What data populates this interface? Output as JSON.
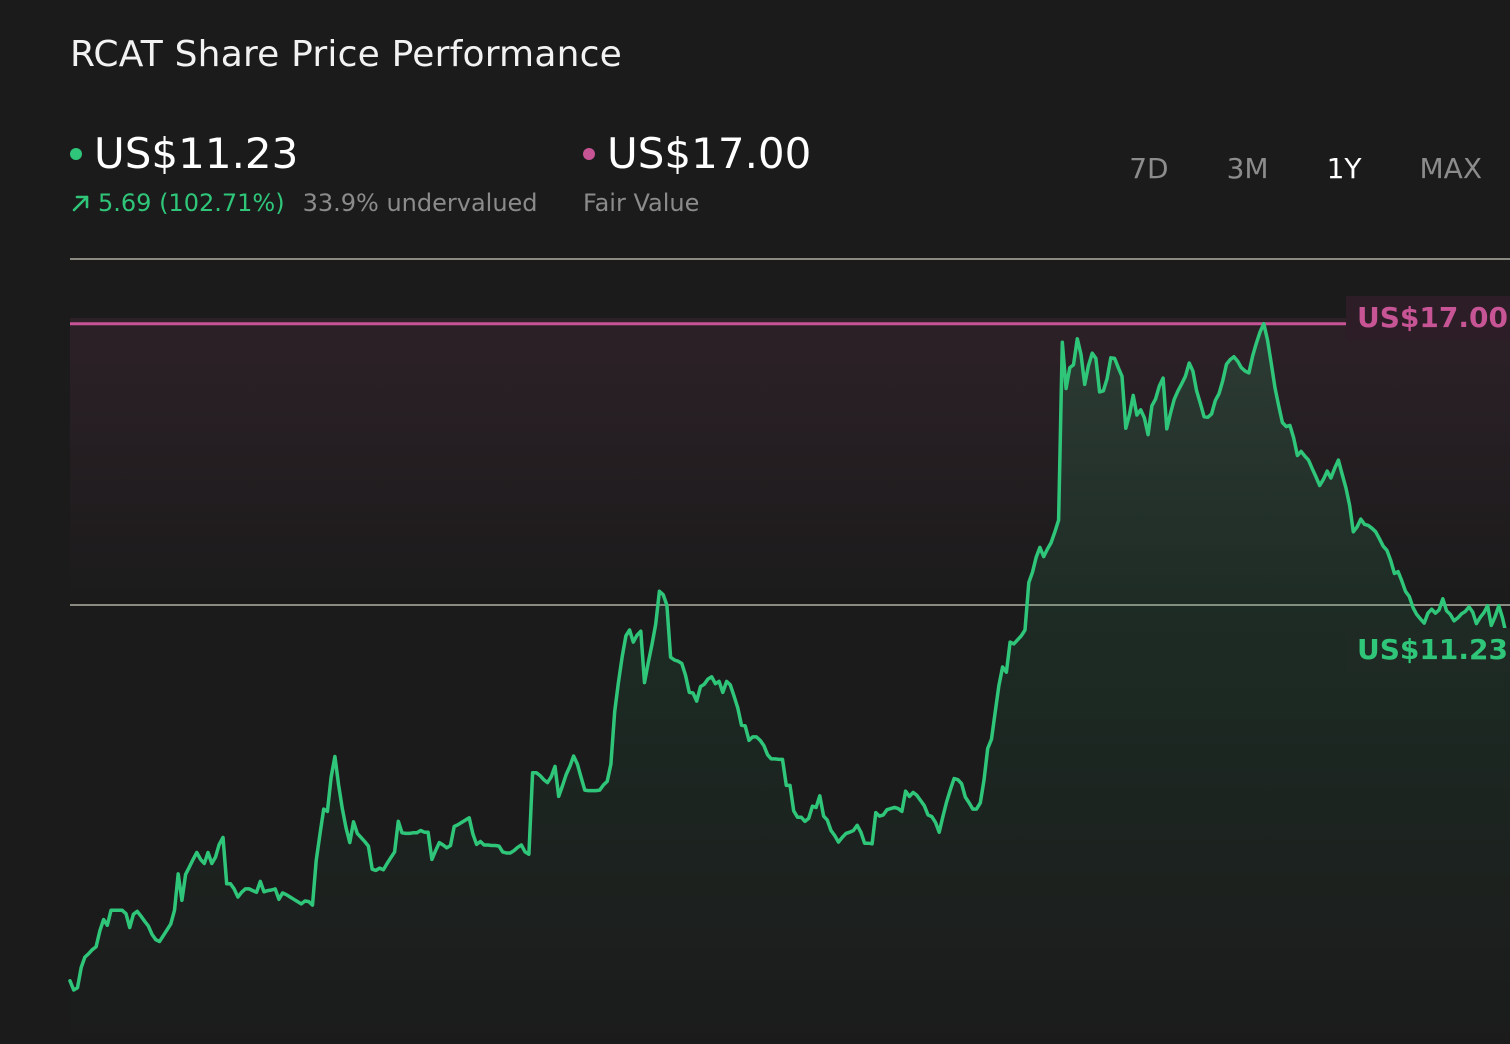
{
  "title": "RCAT Share Price Performance",
  "current": {
    "price": "US$11.23",
    "change": "5.69 (102.71%)",
    "valuation": "33.9% undervalued"
  },
  "fair_value": {
    "price": "US$17.00",
    "label": "Fair Value"
  },
  "range_tabs": [
    "7D",
    "3M",
    "1Y",
    "MAX"
  ],
  "active_range": "1Y",
  "colors": {
    "background": "#1b1b1b",
    "price_line": "#2fc67a",
    "fair_value_line": "#c75495",
    "gridline": "#8a8a80",
    "muted_text": "#8b8b8b"
  },
  "chart_data": {
    "type": "line",
    "series": [
      {
        "values": [
          5.63,
          5.47,
          5.51,
          5.86,
          6.04,
          6.1,
          6.17,
          6.22,
          6.49,
          6.69,
          6.59,
          6.85,
          6.85,
          6.85,
          6.85,
          6.79,
          6.55,
          6.78,
          6.83,
          6.75,
          6.66,
          6.58,
          6.43,
          6.34,
          6.31,
          6.41,
          6.51,
          6.61,
          6.85,
          7.48,
          7.02,
          7.47,
          7.6,
          7.73,
          7.85,
          7.73,
          7.66,
          7.85,
          7.66,
          7.77,
          7.99,
          8.11,
          7.31,
          7.31,
          7.22,
          7.08,
          7.16,
          7.22,
          7.22,
          7.19,
          7.16,
          7.35,
          7.17,
          7.19,
          7.2,
          7.22,
          7.04,
          7.15,
          7.12,
          7.08,
          7.04,
          7.0,
          6.96,
          7.01,
          7.0,
          6.94,
          7.71,
          8.16,
          8.6,
          8.56,
          9.15,
          9.51,
          9.02,
          8.61,
          8.27,
          8.02,
          8.38,
          8.18,
          8.11,
          8.04,
          7.96,
          7.56,
          7.54,
          7.58,
          7.55,
          7.66,
          7.76,
          7.86,
          8.39,
          8.19,
          8.18,
          8.18,
          8.19,
          8.19,
          8.23,
          8.2,
          8.2,
          7.73,
          7.88,
          8.02,
          7.98,
          7.93,
          7.97,
          8.3,
          8.33,
          8.37,
          8.41,
          8.45,
          8.17,
          7.99,
          8.04,
          7.98,
          7.98,
          7.97,
          7.97,
          7.96,
          7.86,
          7.84,
          7.84,
          7.88,
          7.94,
          7.98,
          7.86,
          7.82,
          9.23,
          9.23,
          9.18,
          9.11,
          9.06,
          9.16,
          9.34,
          8.82,
          9.0,
          9.2,
          9.34,
          9.52,
          9.38,
          9.15,
          8.93,
          8.92,
          8.92,
          8.92,
          8.93,
          9.02,
          9.08,
          9.38,
          10.29,
          10.79,
          11.23,
          11.6,
          11.7,
          11.49,
          11.61,
          11.68,
          10.79,
          11.13,
          11.45,
          11.8,
          12.37,
          12.31,
          12.13,
          11.23,
          11.18,
          11.16,
          11.12,
          10.92,
          10.62,
          10.61,
          10.47,
          10.72,
          10.76,
          10.85,
          10.89,
          10.77,
          10.81,
          10.62,
          10.81,
          10.75,
          10.56,
          10.35,
          10.05,
          10.04,
          9.79,
          9.85,
          9.85,
          9.79,
          9.7,
          9.54,
          9.47,
          9.47,
          9.46,
          9.46,
          9.01,
          9.01,
          8.57,
          8.46,
          8.46,
          8.39,
          8.44,
          8.65,
          8.63,
          8.83,
          8.48,
          8.41,
          8.23,
          8.14,
          8.03,
          8.11,
          8.18,
          8.2,
          8.23,
          8.32,
          8.2,
          8.01,
          8.01,
          8.0,
          8.54,
          8.48,
          8.5,
          8.59,
          8.61,
          8.63,
          8.61,
          8.56,
          8.91,
          8.82,
          8.89,
          8.84,
          8.75,
          8.66,
          8.5,
          8.47,
          8.37,
          8.2,
          8.48,
          8.73,
          8.94,
          9.13,
          9.11,
          9.04,
          8.81,
          8.71,
          8.6,
          8.6,
          8.71,
          9.1,
          9.65,
          9.81,
          10.28,
          10.74,
          11.06,
          10.97,
          11.49,
          11.46,
          11.53,
          11.6,
          11.7,
          12.52,
          12.7,
          12.96,
          13.13,
          12.97,
          13.1,
          13.21,
          13.4,
          13.6,
          16.68,
          15.88,
          16.24,
          16.29,
          16.74,
          16.47,
          15.95,
          16.27,
          16.49,
          16.4,
          15.82,
          15.84,
          16.05,
          16.41,
          16.4,
          16.24,
          16.09,
          15.19,
          15.43,
          15.76,
          15.42,
          15.51,
          15.37,
          15.08,
          15.58,
          15.7,
          15.92,
          16.06,
          15.18,
          15.45,
          15.69,
          15.84,
          15.96,
          16.09,
          16.32,
          16.18,
          15.84,
          15.62,
          15.39,
          15.38,
          15.44,
          15.67,
          15.79,
          16.01,
          16.3,
          16.38,
          16.43,
          16.35,
          16.24,
          16.18,
          16.15,
          16.44,
          16.66,
          16.86,
          17.0,
          16.72,
          16.32,
          15.89,
          15.58,
          15.29,
          15.22,
          15.24,
          15.03,
          14.72,
          14.79,
          14.71,
          14.64,
          14.49,
          14.35,
          14.2,
          14.31,
          14.45,
          14.33,
          14.5,
          14.64,
          14.4,
          14.16,
          13.86,
          13.4,
          13.48,
          13.62,
          13.53,
          13.51,
          13.46,
          13.4,
          13.28,
          13.15,
          13.08,
          12.91,
          12.68,
          12.71,
          12.55,
          12.37,
          12.28,
          12.09,
          11.97,
          11.89,
          11.82,
          11.99,
          12.06,
          11.99,
          12.05,
          12.24,
          12.03,
          11.97,
          11.86,
          11.91,
          11.98,
          12.02,
          12.1,
          12.01,
          11.81,
          11.92,
          12.0,
          12.12,
          11.78,
          11.93,
          12.12,
          11.91,
          11.62,
          11.23
        ]
      }
    ],
    "fair_value": 17.0,
    "current_price": 11.23,
    "xlabel": "",
    "ylabel": "",
    "ylim": [
      5.2,
      18.2
    ],
    "grid": false,
    "labels": {
      "fair_value": "US$17.00",
      "current": "US$11.23"
    }
  }
}
